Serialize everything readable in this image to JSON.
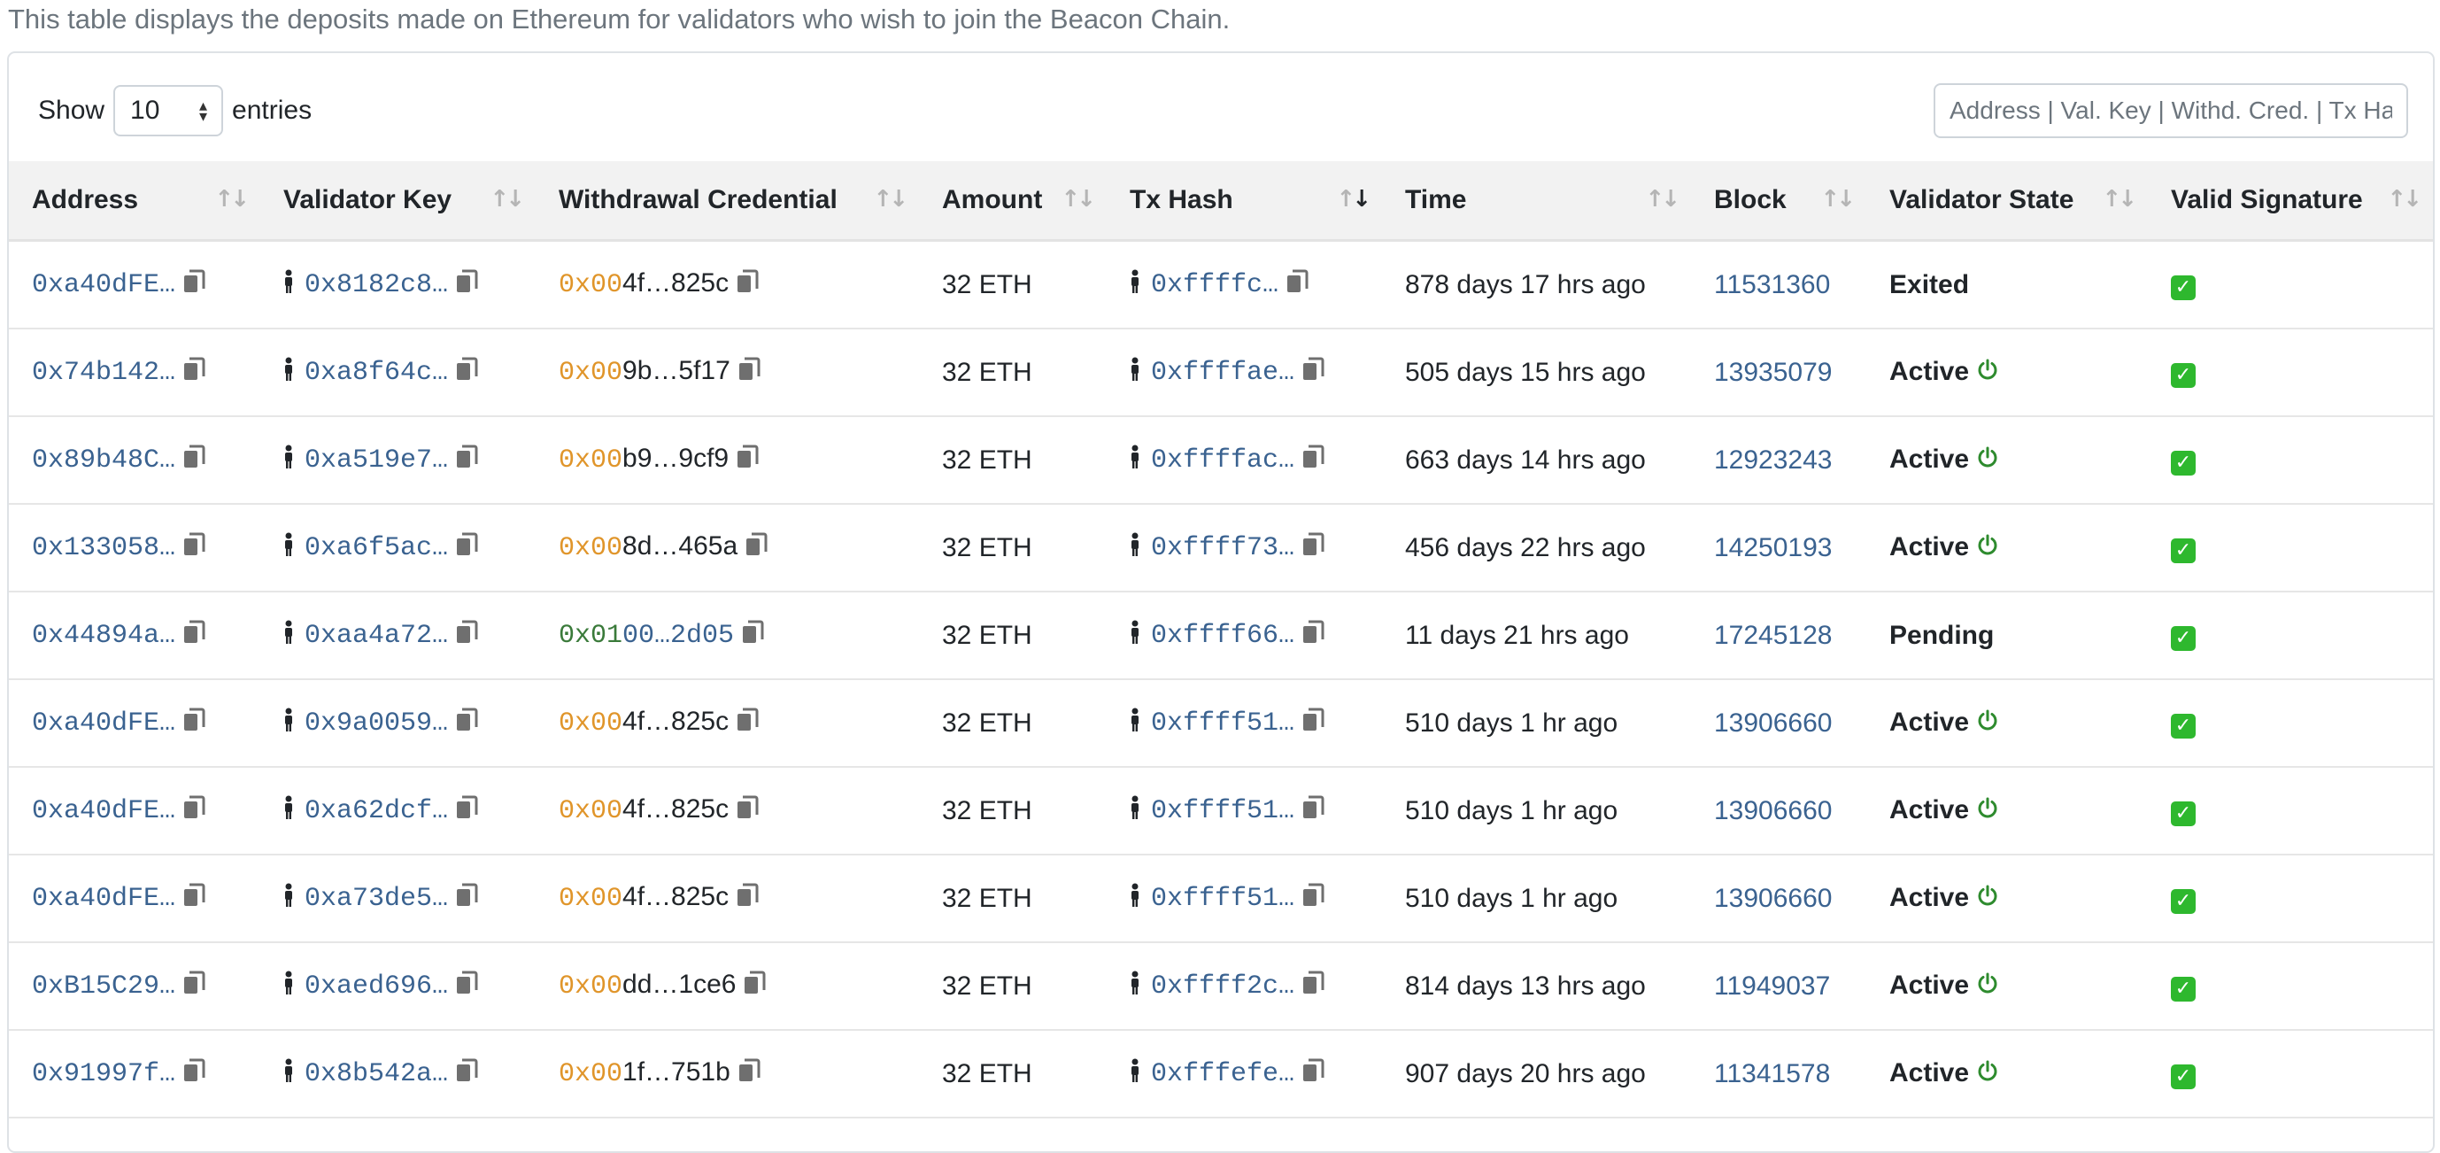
{
  "description": "This table displays the deposits made on Ethereum for validators who wish to join the Beacon Chain.",
  "length_control": {
    "show_label": "Show",
    "selected": "10",
    "entries_label": "entries"
  },
  "search": {
    "placeholder": "Address | Val. Key | Withd. Cred. | Tx Hash"
  },
  "columns": [
    "Address",
    "Validator Key",
    "Withdrawal Credential",
    "Amount",
    "Tx Hash",
    "Time",
    "Block",
    "Validator State",
    "Valid Signature"
  ],
  "sorted_column": "Tx Hash",
  "sort_direction": "descending",
  "colors": {
    "link": "#3a6290",
    "cred_00": "#e0952a",
    "cred_01": "#3a7a3a",
    "active_icon": "#2e8b2e",
    "check": "#2eb82e"
  },
  "rows": [
    {
      "address": "0xa40dFE…",
      "validator_key": "0x8182c8…",
      "cred_prefix": "0x00",
      "cred_type": "00",
      "cred_rest": "4f…825c",
      "amount": "32 ETH",
      "tx_hash": "0xffffc…",
      "time": "878 days 17 hrs ago",
      "block": "11531360",
      "state": "Exited",
      "state_icon": "",
      "signature": "✓"
    },
    {
      "address": "0x74b142…",
      "validator_key": "0xa8f64c…",
      "cred_prefix": "0x00",
      "cred_type": "00",
      "cred_rest": "9b…5f17",
      "amount": "32 ETH",
      "tx_hash": "0xffffae…",
      "time": "505 days 15 hrs ago",
      "block": "13935079",
      "state": "Active",
      "state_icon": "power-icon",
      "signature": "✓"
    },
    {
      "address": "0x89b48C…",
      "validator_key": "0xa519e7…",
      "cred_prefix": "0x00",
      "cred_type": "00",
      "cred_rest": "b9…9cf9",
      "amount": "32 ETH",
      "tx_hash": "0xffffac…",
      "time": "663 days 14 hrs ago",
      "block": "12923243",
      "state": "Active",
      "state_icon": "power-icon",
      "signature": "✓"
    },
    {
      "address": "0x133058…",
      "validator_key": "0xa6f5ac…",
      "cred_prefix": "0x00",
      "cred_type": "00",
      "cred_rest": "8d…465a",
      "amount": "32 ETH",
      "tx_hash": "0xffff73…",
      "time": "456 days 22 hrs ago",
      "block": "14250193",
      "state": "Active",
      "state_icon": "power-icon",
      "signature": "✓"
    },
    {
      "address": "0x44894a…",
      "validator_key": "0xaa4a72…",
      "cred_prefix": "0x01",
      "cred_type": "01",
      "cred_rest": "00…2d05",
      "amount": "32 ETH",
      "tx_hash": "0xffff66…",
      "time": "11 days 21 hrs ago",
      "block": "17245128",
      "state": "Pending",
      "state_icon": "",
      "signature": "✓"
    },
    {
      "address": "0xa40dFE…",
      "validator_key": "0x9a0059…",
      "cred_prefix": "0x00",
      "cred_type": "00",
      "cred_rest": "4f…825c",
      "amount": "32 ETH",
      "tx_hash": "0xffff51…",
      "time": "510 days 1 hr ago",
      "block": "13906660",
      "state": "Active",
      "state_icon": "power-icon",
      "signature": "✓"
    },
    {
      "address": "0xa40dFE…",
      "validator_key": "0xa62dcf…",
      "cred_prefix": "0x00",
      "cred_type": "00",
      "cred_rest": "4f…825c",
      "amount": "32 ETH",
      "tx_hash": "0xffff51…",
      "time": "510 days 1 hr ago",
      "block": "13906660",
      "state": "Active",
      "state_icon": "power-icon",
      "signature": "✓"
    },
    {
      "address": "0xa40dFE…",
      "validator_key": "0xa73de5…",
      "cred_prefix": "0x00",
      "cred_type": "00",
      "cred_rest": "4f…825c",
      "amount": "32 ETH",
      "tx_hash": "0xffff51…",
      "time": "510 days 1 hr ago",
      "block": "13906660",
      "state": "Active",
      "state_icon": "power-icon",
      "signature": "✓"
    },
    {
      "address": "0xB15C29…",
      "validator_key": "0xaed696…",
      "cred_prefix": "0x00",
      "cred_type": "00",
      "cred_rest": "dd…1ce6",
      "amount": "32 ETH",
      "tx_hash": "0xffff2c…",
      "time": "814 days 13 hrs ago",
      "block": "11949037",
      "state": "Active",
      "state_icon": "power-icon",
      "signature": "✓"
    },
    {
      "address": "0x91997f…",
      "validator_key": "0x8b542a…",
      "cred_prefix": "0x00",
      "cred_type": "00",
      "cred_rest": "1f…751b",
      "amount": "32 ETH",
      "tx_hash": "0xfffefe…",
      "time": "907 days 20 hrs ago",
      "block": "11341578",
      "state": "Active",
      "state_icon": "power-icon",
      "signature": "✓"
    }
  ]
}
